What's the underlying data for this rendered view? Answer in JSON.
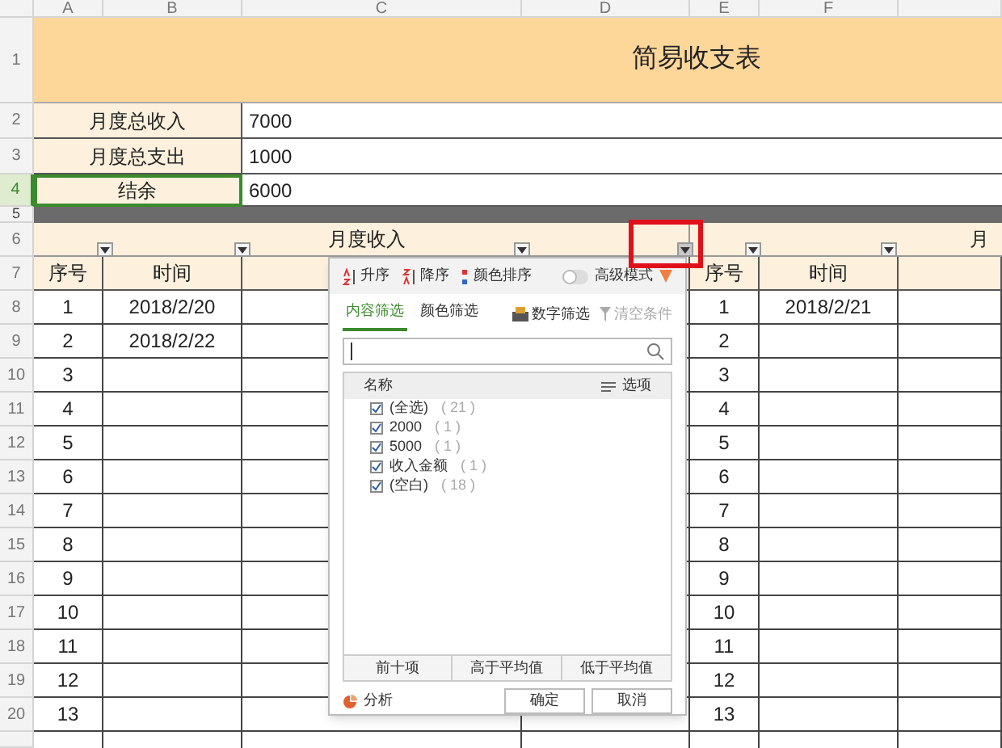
{
  "column_headers": [
    "A",
    "B",
    "C",
    "D",
    "E",
    "F"
  ],
  "title": {
    "row": "1",
    "text": "简易收支表"
  },
  "summary": [
    {
      "row": "2",
      "label": "月度总收入",
      "value": "7000",
      "selected": false
    },
    {
      "row": "3",
      "label": "月度总支出",
      "value": "1000",
      "selected": false
    },
    {
      "row": "4",
      "label": "结余",
      "value": "6000",
      "selected": true
    }
  ],
  "separator_row": "5",
  "group_header": {
    "row": "6",
    "left": "月度收入",
    "right": "月"
  },
  "filter_buttons": [
    {
      "highlighted": false
    },
    {
      "highlighted": false
    },
    {
      "highlighted": false
    },
    {
      "highlighted": true
    },
    {
      "highlighted": false
    },
    {
      "highlighted": false
    }
  ],
  "table_header": {
    "row": "7",
    "left": [
      "序号",
      "时间"
    ],
    "right": [
      "序号",
      "时间"
    ]
  },
  "rows": [
    {
      "row": "8",
      "left_no": "1",
      "left_time": "2018/2/20",
      "right_no": "1",
      "right_time": "2018/2/21"
    },
    {
      "row": "9",
      "left_no": "2",
      "left_time": "2018/2/22",
      "right_no": "2"
    },
    {
      "row": "10",
      "left_no": "3",
      "right_no": "3"
    },
    {
      "row": "11",
      "left_no": "4",
      "right_no": "4"
    },
    {
      "row": "12",
      "left_no": "5",
      "right_no": "5"
    },
    {
      "row": "13",
      "left_no": "6",
      "right_no": "6"
    },
    {
      "row": "14",
      "left_no": "7",
      "right_no": "7"
    },
    {
      "row": "15",
      "left_no": "8",
      "right_no": "8"
    },
    {
      "row": "16",
      "left_no": "9",
      "right_no": "9"
    },
    {
      "row": "17",
      "left_no": "10",
      "right_no": "10"
    },
    {
      "row": "18",
      "left_no": "11",
      "right_no": "11"
    },
    {
      "row": "19",
      "left_no": "12",
      "right_no": "12"
    },
    {
      "row": "20",
      "left_no": "13",
      "right_no": "13"
    }
  ],
  "filter_popup": {
    "sort": [
      "升序",
      "降序",
      "颜色排序"
    ],
    "advanced_mode": {
      "label": "高级模式",
      "on": false
    },
    "tabs": [
      {
        "label": "内容筛选",
        "selected": true
      },
      {
        "label": "颜色筛选",
        "selected": false
      }
    ],
    "number_filter": "数字筛选",
    "clear_conditions": {
      "label": "清空条件",
      "disabled": true
    },
    "list_header": "名称",
    "options": "选项",
    "items": [
      {
        "label": "(全选)",
        "count": "( 21 )",
        "checked": true
      },
      {
        "label": "2000",
        "count": "( 1 )",
        "checked": true
      },
      {
        "label": "5000",
        "count": "( 1 )",
        "checked": true
      },
      {
        "label": "收入金额",
        "count": "( 1 )",
        "checked": true
      },
      {
        "label": "(空白)",
        "count": "( 18 )",
        "checked": true
      }
    ],
    "quick_filters": [
      "前十项",
      "高于平均值",
      "低于平均值"
    ],
    "analysis": "分析",
    "buttons": [
      "确定",
      "取消"
    ]
  }
}
